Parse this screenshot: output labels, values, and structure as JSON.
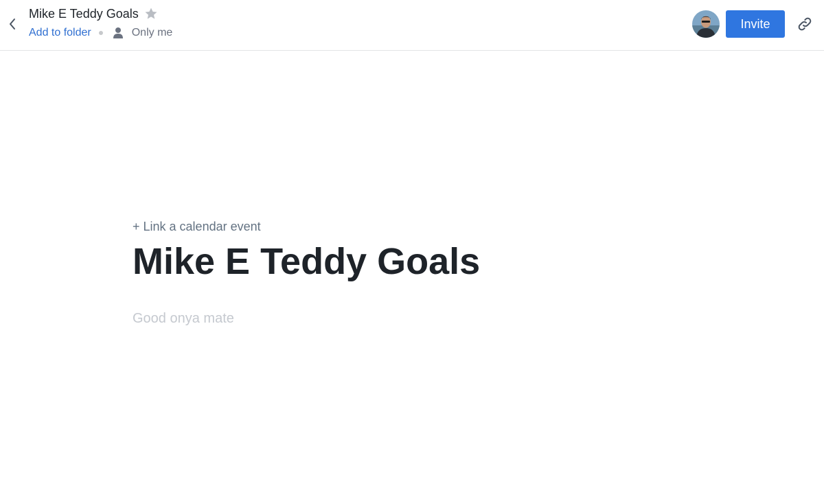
{
  "header": {
    "back_icon": "chevron-left-icon",
    "title": "Mike E Teddy Goals",
    "star_icon": "star-icon",
    "add_to_folder": "Add to folder",
    "sharing_icon": "person-icon",
    "sharing": "Only me",
    "avatar_icon": "user-avatar",
    "invite_label": "Invite",
    "link_icon": "link-icon"
  },
  "document": {
    "calendar_link": "+ Link a calendar event",
    "title": "Mike E Teddy Goals",
    "body_placeholder": "Good onya mate"
  },
  "colors": {
    "accent": "#2f76e0",
    "link": "#2f6fd1",
    "title_text": "#1e2329",
    "muted_text": "#637282",
    "placeholder_text": "#c5c9cf"
  }
}
